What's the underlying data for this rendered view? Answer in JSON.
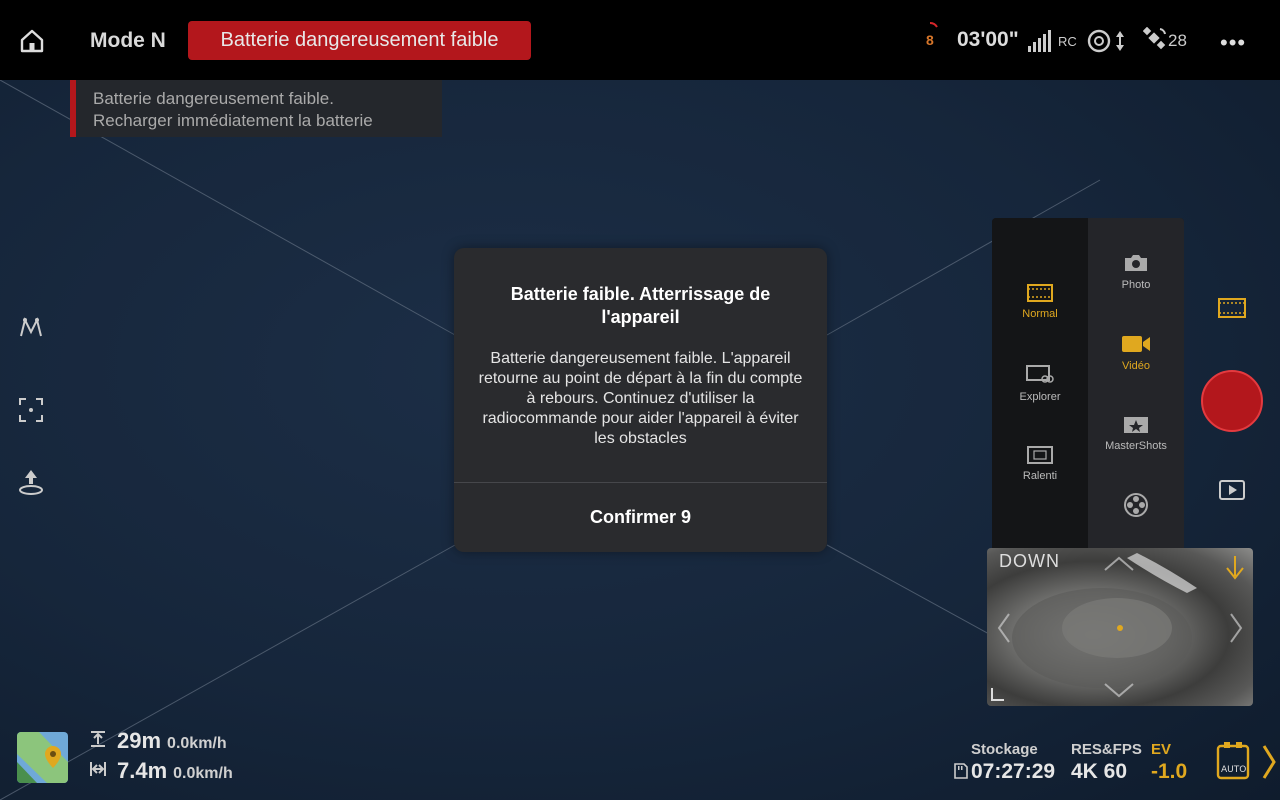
{
  "colors": {
    "accent": "#e0a81f",
    "danger": "#b3171c",
    "battery": "#d7762a"
  },
  "topbar": {
    "mode": "Mode N",
    "warning_pill": "Batterie dangereusement faible",
    "battery_countdown": "8",
    "flight_time": "03'00\"",
    "rc_label": "RC",
    "satellites": "28",
    "more_label": "•••",
    "icons": [
      "home-icon",
      "signal-icon",
      "obstacle-sensing-icon",
      "satellite-icon",
      "more-icon"
    ]
  },
  "toast": {
    "line1": "Batterie dangereusement faible.",
    "line2": "Recharger immédiatement la batterie"
  },
  "left_tools": [
    "waypoint-icon",
    "focus-frame-icon",
    "return-home-icon"
  ],
  "dialog": {
    "title": "Batterie faible. Atterrissage de l'appareil",
    "body": "Batterie dangereusement faible. L'appareil retourne au point de départ à la fin du compte à rebours. Continuez d'utiliser la radiocommande pour aider l'appareil à éviter les obstacles",
    "button": "Confirmer 9"
  },
  "mode_panel": {
    "submodes": [
      {
        "label": "Normal",
        "icon": "film-icon",
        "active": true
      },
      {
        "label": "Explorer",
        "icon": "explorer-icon",
        "active": false
      },
      {
        "label": "Ralenti",
        "icon": "slow-motion-icon",
        "active": false
      }
    ],
    "modes": [
      {
        "label": "Photo",
        "icon": "camera-icon",
        "active": false
      },
      {
        "label": "Vidéo",
        "icon": "video-icon",
        "active": true
      },
      {
        "label": "MasterShots",
        "icon": "mastershots-icon",
        "active": false
      },
      {
        "label": "",
        "icon": "film-reel-icon",
        "active": false
      }
    ]
  },
  "minimap": {
    "label": "DOWN"
  },
  "telemetry": {
    "altitude": "29m",
    "vertical_speed": "0.0km/h",
    "distance": "7.4m",
    "horizontal_speed": "0.0km/h"
  },
  "camera_settings": {
    "storage_label": "Stockage",
    "storage_value": "07:27:29",
    "res_label": "RES&FPS",
    "res_value": "4K 60",
    "ev_label": "EV",
    "ev_value": "-1.0",
    "auto_label": "AUTO"
  }
}
